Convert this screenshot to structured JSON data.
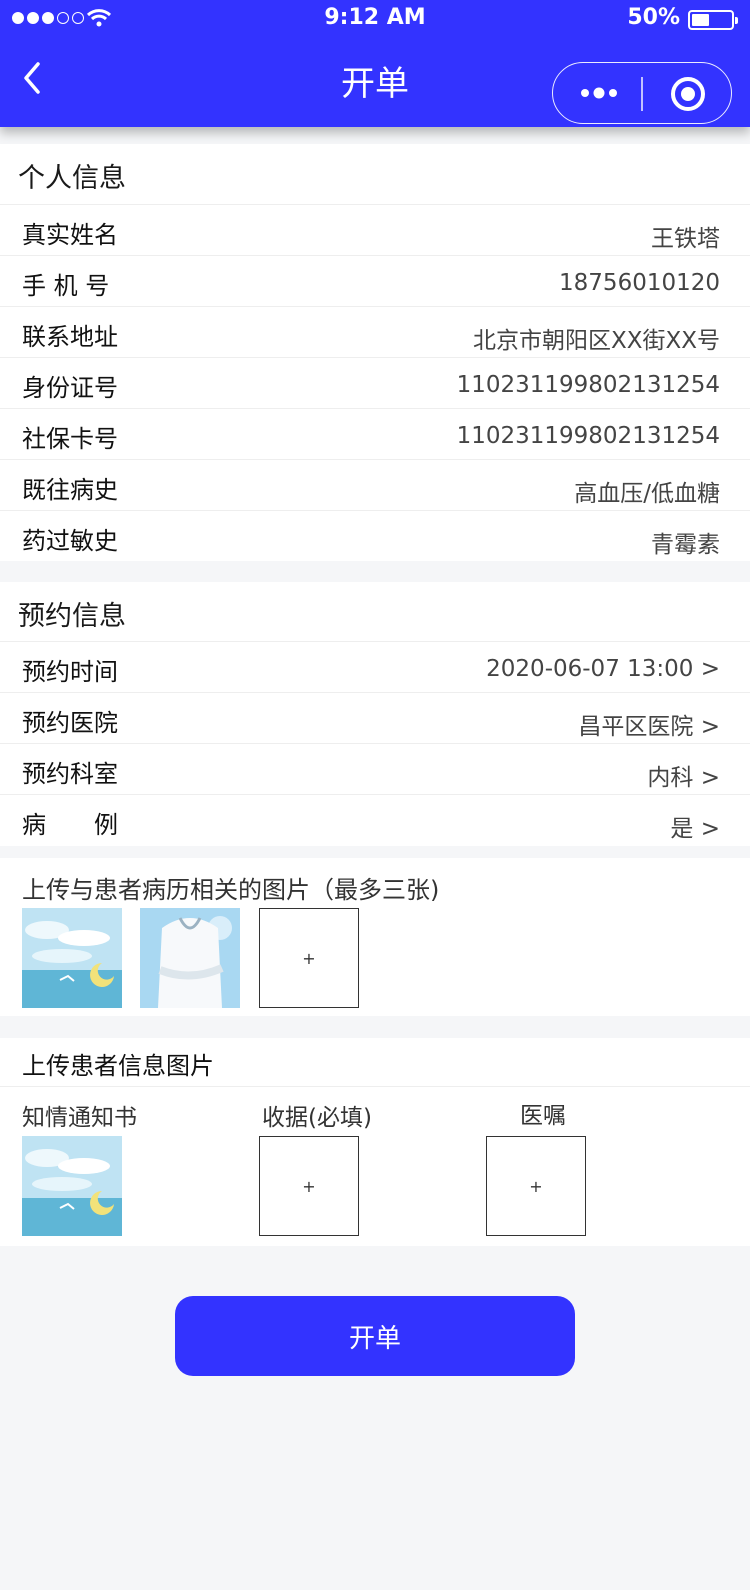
{
  "status_bar": {
    "time": "9:12 AM",
    "battery": "50%",
    "battery_level": 0.5
  },
  "nav": {
    "title": "开单",
    "back_icon": "chevron-left-icon",
    "more_icon": "more-dots-icon",
    "close_icon": "target-circle-icon"
  },
  "personal": {
    "title": "个人信息",
    "rows": [
      {
        "label": "真实姓名",
        "value": "王铁塔"
      },
      {
        "label": "手 机 号",
        "value": "18756010120"
      },
      {
        "label": "联系地址",
        "value": "北京市朝阳区XX街XX号"
      },
      {
        "label": "身份证号",
        "value": "110231199802131254"
      },
      {
        "label": "社保卡号",
        "value": "110231199802131254"
      },
      {
        "label": "既往病史",
        "value": "高血压/低血糖"
      },
      {
        "label": "药过敏史",
        "value": "青霉素"
      }
    ]
  },
  "appointment": {
    "title": "预约信息",
    "rows": [
      {
        "label": "预约时间",
        "value": "2020-06-07  13:00 >"
      },
      {
        "label": "预约医院",
        "value": "昌平区医院 >"
      },
      {
        "label": "预约科室",
        "value": "内科 >"
      },
      {
        "label": "病　　例",
        "value": "是 >"
      }
    ]
  },
  "medical_upload": {
    "title": "上传与患者病历相关的图片（最多三张)",
    "add_label": "+"
  },
  "patient_upload": {
    "title": "上传患者信息图片",
    "columns": [
      {
        "label": "知情通知书"
      },
      {
        "label": "收据(必填)",
        "add_label": "+"
      },
      {
        "label": "医嘱",
        "add_label": "+"
      }
    ]
  },
  "submit": {
    "label": "开单"
  },
  "colors": {
    "brand": "#3333ff",
    "background": "#f5f6f8"
  }
}
